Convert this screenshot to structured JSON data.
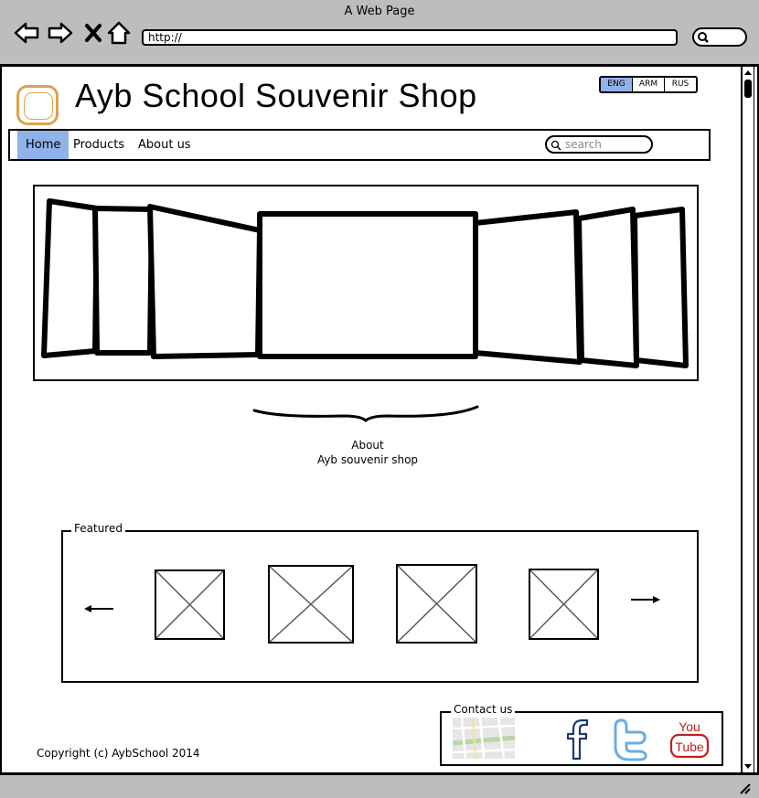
{
  "browser": {
    "window_title": "A Web Page",
    "url": "http://"
  },
  "header": {
    "site_title": "Ayb School Souvenir Shop",
    "languages": [
      "ENG",
      "ARM",
      "RUS"
    ],
    "active_language": "ENG"
  },
  "nav": {
    "items": [
      "Home",
      "Products",
      "About us"
    ],
    "active": "Home",
    "search_placeholder": "search"
  },
  "about": {
    "line1": "About",
    "line2": "Ayb souvenir shop"
  },
  "featured": {
    "label": "Featured",
    "item_count": 4
  },
  "footer": {
    "copyright": "Copyright (c) AybSchool 2014",
    "contact_label": "Contact us",
    "social": [
      "facebook",
      "twitter",
      "YouTube"
    ]
  },
  "colors": {
    "chrome": "#bdbdbd",
    "accent": "#8fb2e8",
    "logo": "#e0a050",
    "facebook": "#1a3a6e",
    "twitter": "#6aaee0",
    "youtube": "#c0201e"
  }
}
